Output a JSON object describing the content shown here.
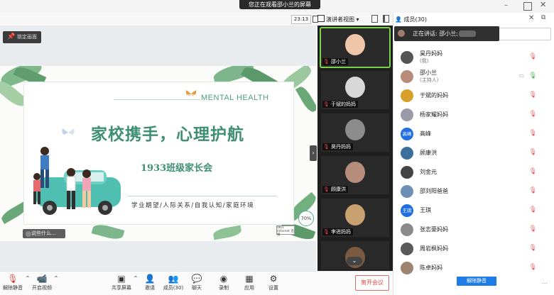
{
  "viewing_banner": "您正在观看邵小兰的屏幕",
  "meeting_time": "23:13",
  "speaker_view_label": "演讲者视图",
  "lock_screen_label": "锁定画面",
  "slide": {
    "title": "家校携手，心理护航",
    "english_title": "MENTAL HEALTH",
    "subtitle": "1933班级家长会",
    "tags": "学业期望/人际关系/自我认知/家庭环境",
    "network_percent": "70%",
    "badge_text": "0K/s Internet 连接",
    "hint_bubble": "说些什么…"
  },
  "video_tiles": [
    {
      "label": "邵小兰",
      "active": true
    },
    {
      "label": "于斌的妈妈",
      "active": false
    },
    {
      "label": "昊丹妈妈",
      "active": false
    },
    {
      "label": "顾康洪",
      "active": false
    },
    {
      "label": "李进妈妈",
      "active": false
    },
    {
      "label": "",
      "active": false
    }
  ],
  "panel": {
    "header": "成员(30)",
    "speaking_label": "正在讲话: 邵小兰;",
    "unmute_all_label": "解除静音",
    "members": [
      {
        "name": "昊丹妈妈",
        "role": "(我)",
        "avatar_text": "",
        "avatar_color": "#555555"
      },
      {
        "name": "邵小兰",
        "role": "(主持人)",
        "avatar_text": "",
        "avatar_color": "#b98b7a"
      },
      {
        "name": "于斌的妈妈",
        "role": "",
        "avatar_text": "",
        "avatar_color": "#d7a02a"
      },
      {
        "name": "杨家耀妈妈",
        "role": "",
        "avatar_text": "",
        "avatar_color": "#9a9aa8"
      },
      {
        "name": "高峰",
        "role": "",
        "avatar_text": "高峰",
        "avatar_color": "#1f6fe0"
      },
      {
        "name": "顾康洪",
        "role": "",
        "avatar_text": "",
        "avatar_color": "#3c6f9a"
      },
      {
        "name": "刘金元",
        "role": "",
        "avatar_text": "",
        "avatar_color": "#444444"
      },
      {
        "name": "邵刘阳爸爸",
        "role": "",
        "avatar_text": "",
        "avatar_color": "#6d8fb6"
      },
      {
        "name": "王琪",
        "role": "",
        "avatar_text": "王琪",
        "avatar_color": "#1f6fe0"
      },
      {
        "name": "张志豪妈妈",
        "role": "",
        "avatar_text": "",
        "avatar_color": "#8a8a8a"
      },
      {
        "name": "周岩枫妈妈",
        "role": "",
        "avatar_text": "",
        "avatar_color": "#5a5a5a"
      },
      {
        "name": "陈卓妈妈",
        "role": "",
        "avatar_text": "",
        "avatar_color": "#9c8470"
      }
    ]
  },
  "toolbar": {
    "unmute": "解除静音",
    "start_video": "开启视频",
    "share_screen": "共享屏幕",
    "invite": "邀请",
    "members": "成员(30)",
    "chat": "聊天",
    "record": "录制",
    "apps": "应用",
    "settings": "设置",
    "leave": "离开会议"
  },
  "colors": {
    "accent_green": "#3f8f74",
    "leave_red": "#e24a4a",
    "primary_blue": "#1f7be6",
    "active_tile": "#7bd34a"
  }
}
